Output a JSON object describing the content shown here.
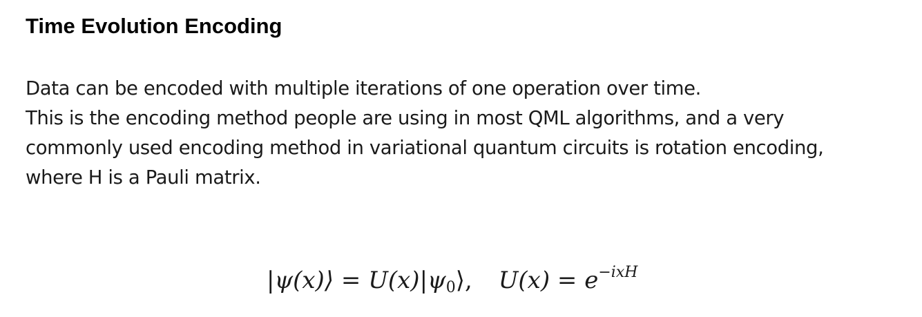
{
  "slide": {
    "title": "Time Evolution Encoding",
    "body_lines": [
      "Data can be encoded with multiple iterations of one operation over time.",
      "This is the encoding method people are using in most QML algorithms, and a very",
      "commonly used encoding method in variational quantum circuits is rotation encoding,",
      "where H is a Pauli matrix."
    ],
    "formula": {
      "lhs_state": "|ψ(x)⟩ = ",
      "unitary": "U(x)",
      "initial_state": "|ψ",
      "initial_sub": "0",
      "initial_close": "⟩,",
      "rhs_lhs": "U(x) = e",
      "exponent": "−ixH"
    }
  }
}
